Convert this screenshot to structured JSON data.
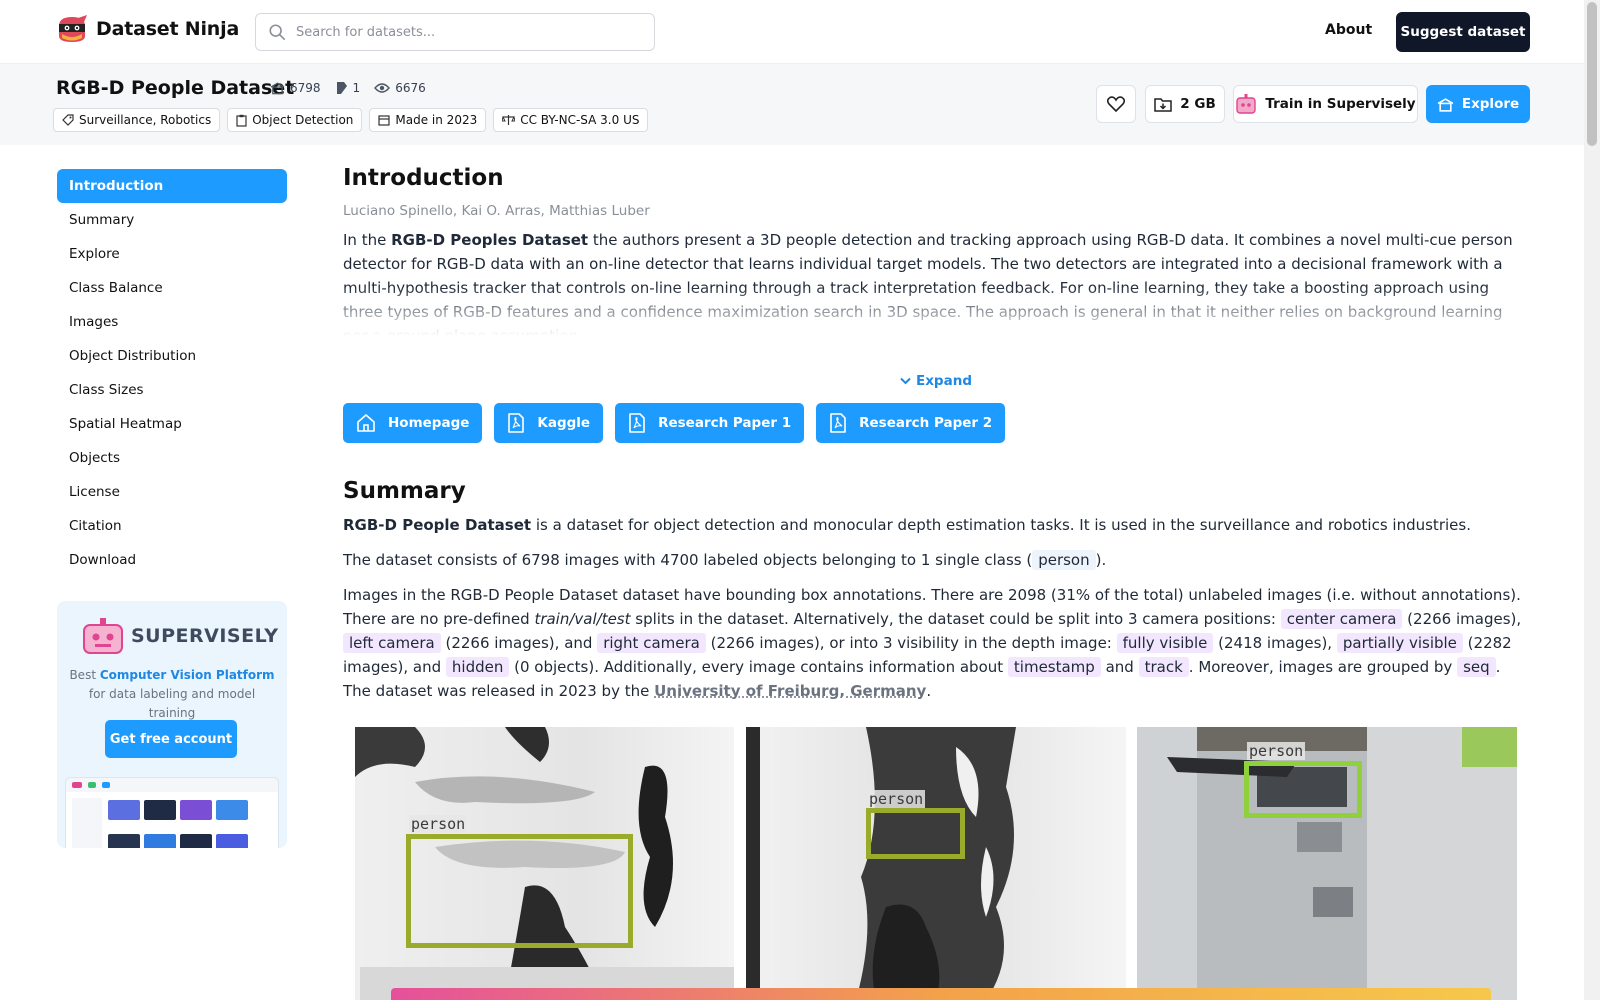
{
  "nav": {
    "brand": "Dataset Ninja",
    "search_placeholder": "Search for datasets...",
    "about": "About",
    "suggest": "Suggest dataset"
  },
  "dataset": {
    "title": "RGB-D People Dataset",
    "stats": {
      "images": "6798",
      "classes": "1",
      "views": "6676"
    },
    "tags": [
      {
        "icon": "tag-icon",
        "label": "Surveillance, Robotics"
      },
      {
        "icon": "clipboard-icon",
        "label": "Object Detection"
      },
      {
        "icon": "calendar-icon",
        "label": "Made in 2023"
      },
      {
        "icon": "scale-icon",
        "label": "CC BY-NC-SA 3.0 US"
      }
    ],
    "size": "2 GB",
    "train": "Train in Supervisely",
    "explore": "Explore"
  },
  "sidebar": {
    "items": [
      "Introduction",
      "Summary",
      "Explore",
      "Class Balance",
      "Images",
      "Object Distribution",
      "Class Sizes",
      "Spatial Heatmap",
      "Objects",
      "License",
      "Citation",
      "Download"
    ],
    "active_index": 0
  },
  "promo": {
    "brand": "SUPERVISELY",
    "text_pre": "Best ",
    "text_link": "Computer Vision Platform",
    "text_post": " for data labeling and model training",
    "button": "Get free account"
  },
  "intro": {
    "heading": "Introduction",
    "authors": "Luciano Spinello, Kai O. Arras, Matthias Luber",
    "text_pre": "In the ",
    "text_bold": "RGB-D Peoples Dataset",
    "text_post": " the authors present a 3D people detection and tracking approach using RGB-D data. It combines a novel multi-cue person detector for RGB-D data with an on-line detector that learns individual target models. The two detectors are integrated into a decisional framework with a multi-hypothesis tracker that controls on-line learning through a track interpretation feedback. For on-line learning, they take a boosting approach using three types of RGB-D features and a confidence maximization search in 3D space. The approach is general in that it neither relies on background learning nor a ground plane assumption.",
    "expand": "Expand",
    "links": [
      {
        "icon": "home-icon",
        "label": "Homepage"
      },
      {
        "icon": "pdf-icon",
        "label": "Kaggle"
      },
      {
        "icon": "pdf-icon",
        "label": "Research Paper 1"
      },
      {
        "icon": "pdf-icon",
        "label": "Research Paper 2"
      }
    ]
  },
  "summary": {
    "heading": "Summary",
    "p1_bold": "RGB-D People Dataset",
    "p1_rest": " is a dataset for object detection and monocular depth estimation tasks. It is used in the surveillance and robotics industries.",
    "p2_pre": "The dataset consists of 6798 images with 4700 labeled objects belonging to 1 single class (",
    "p2_chip": "person",
    "p2_post": ").",
    "p3_a": "Images in the RGB-D People Dataset dataset have bounding box annotations. There are 2098 (31% of the total) unlabeled images (i.e. without annotations). There are no pre-defined ",
    "p3_italic": "train/val/test",
    "p3_b": " splits in the dataset. Alternatively, the dataset could be split into 3 camera positions: ",
    "chip_center": "center camera",
    "p3_c": " (2266 images), ",
    "chip_left": "left camera",
    "p3_d": " (2266 images), and ",
    "chip_right": "right camera",
    "p3_e": " (2266 images), or into 3 visibility in the depth image: ",
    "chip_fully": "fully visible",
    "p3_f": " (2418 images), ",
    "chip_partial": "partially visible",
    "p3_g": " (2282 images), and ",
    "chip_hidden": "hidden",
    "p3_h": " (0 objects). Additionally, every image contains information about ",
    "chip_timestamp": "timestamp",
    "p3_i": " and ",
    "chip_track": "track",
    "p3_j": ". Moreover, images are grouped by ",
    "chip_seq": "seq",
    "p3_k": ". The dataset was released in 2023 by the ",
    "org": "University of Freiburg, Germany",
    "p3_l": "."
  },
  "preview": {
    "labels": [
      "person",
      "person",
      "person"
    ]
  }
}
